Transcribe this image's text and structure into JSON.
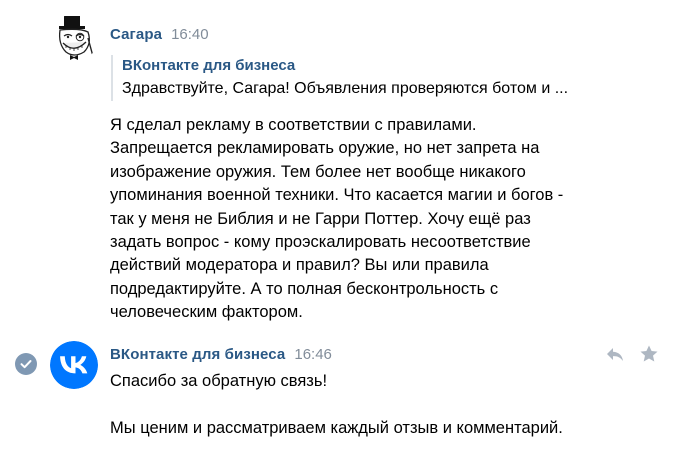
{
  "messages": [
    {
      "author": "Сагара",
      "time": "16:40",
      "avatar_icon": "trollface-avatar-icon",
      "reply": {
        "author": "ВКонтакте для бизнеса",
        "text": "Здравствуйте, Сагара! Объявления проверяются ботом и ..."
      },
      "lines": [
        "Я сделал рекламу в соответствии с правилами.",
        "Запрещается рекламировать оружие, но нет запрета на",
        "изображение оружия. Тем более нет вообще никакого",
        "упоминания военной техники. Что касается магии и богов -",
        "так у меня не Библия и не Гарри Поттер. Хочу ещё раз",
        "задать вопрос - кому проэскалировать несоответствие",
        "действий модератора и правил? Вы или правила",
        "подредактируйте. А то полная бесконтрольность с",
        "человеческим фактором."
      ]
    },
    {
      "author": "ВКонтакте для бизнеса",
      "time": "16:46",
      "avatar_icon": "vk-logo-icon",
      "status_icon": "read-check-icon",
      "lines": [
        "Спасибо за обратную связь!",
        "",
        "Мы ценим и рассматриваем каждый отзыв и комментарий."
      ],
      "actions": [
        "reply-icon",
        "star-icon"
      ]
    }
  ],
  "colors": {
    "author": "#2a5885",
    "time": "#818c99",
    "vk_brand": "#0077ff",
    "check": "#7f98b3",
    "action_icon": "#aeb7c2",
    "quote_bar": "#dce1e6"
  }
}
